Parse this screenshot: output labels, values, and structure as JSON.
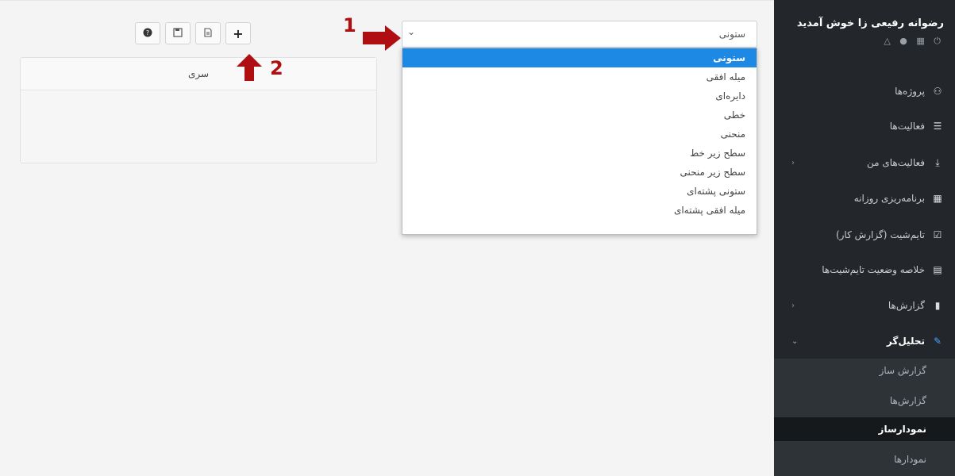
{
  "sidebar": {
    "welcome": "رضوانه رفیعی زا خوش آمدید",
    "icons_row": "⏻ ▦ ● △",
    "items": [
      {
        "label": "پروژه‌ها",
        "icon": "users-icon",
        "glyph": "⚇",
        "chevron": ""
      },
      {
        "label": "فعالیت‌ها",
        "icon": "list-icon",
        "glyph": "☰",
        "chevron": ""
      },
      {
        "label": "فعالیت‌های من",
        "icon": "download-icon",
        "glyph": "⤓",
        "chevron": "‹"
      },
      {
        "label": "برنامه‌ریزی روزانه",
        "icon": "calendar-icon",
        "glyph": "▦",
        "chevron": ""
      },
      {
        "label": "تایم‌شیت (گزارش کار)",
        "icon": "calendar-check-icon",
        "glyph": "☑",
        "chevron": ""
      },
      {
        "label": "خلاصه وضعیت تایم‌شیت‌ها",
        "icon": "table-icon",
        "glyph": "▤",
        "chevron": ""
      },
      {
        "label": "گزارش‌ها",
        "icon": "file-icon",
        "glyph": "▮",
        "chevron": "‹"
      },
      {
        "label": "تحلیل‌گر",
        "icon": "pen-icon",
        "glyph": "✎",
        "chevron": "⌄"
      }
    ],
    "submenu": [
      "گزارش ساز",
      "گزارش‌ها",
      "نمودارساز",
      "نمودارها"
    ]
  },
  "chart_type_select": {
    "value": "ستونی",
    "arrow": "⌄",
    "options": [
      "ستونی",
      "میله افقی",
      "دایره‌ای",
      "خطی",
      "منحنی",
      "سطح زیر خط",
      "سطح زیر منحنی",
      "ستونی پشته‌ای",
      "میله افقی پشته‌ای"
    ]
  },
  "annotations": {
    "one": "1",
    "two": "2"
  },
  "toolbar": {
    "help": "❓",
    "save": "🖫",
    "new": "🗎",
    "add": "+"
  },
  "series_panel": {
    "header": "سری"
  },
  "colors": {
    "accent": "#1e88e5",
    "annotation": "#b00f12",
    "sidebar_bg": "#23272b"
  }
}
